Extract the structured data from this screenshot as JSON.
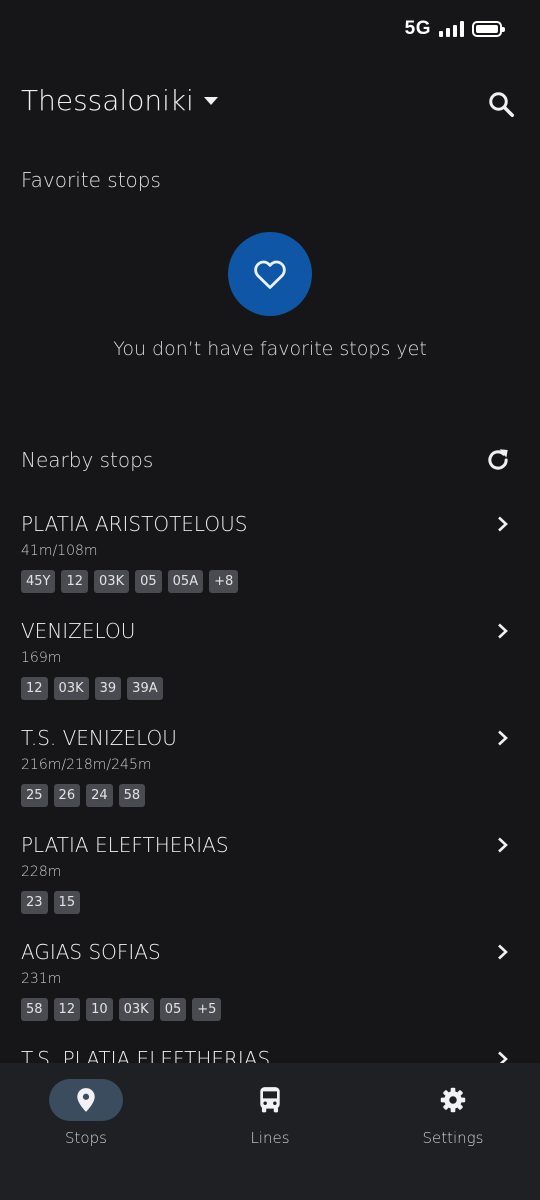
{
  "status_bar": {
    "network": "5G"
  },
  "header": {
    "city": "Thessaloniki"
  },
  "favorites": {
    "title": "Favorite stops",
    "empty_message": "You don’t have favorite stops yet"
  },
  "nearby": {
    "title": "Nearby stops",
    "stops": [
      {
        "name": "PLATIA ARISTOTELOUS",
        "distance": "41m/108m",
        "lines": [
          "45Y",
          "12",
          "03K",
          "05",
          "05A",
          "+8"
        ]
      },
      {
        "name": "VENIZELOU",
        "distance": "169m",
        "lines": [
          "12",
          "03K",
          "39",
          "39A"
        ]
      },
      {
        "name": "T.S. VENIZELOU",
        "distance": "216m/218m/245m",
        "lines": [
          "25",
          "26",
          "24",
          "58"
        ]
      },
      {
        "name": "PLATIA ELEFTHERIAS",
        "distance": "228m",
        "lines": [
          "23",
          "15"
        ]
      },
      {
        "name": "AGIAS SOFIAS",
        "distance": "231m",
        "lines": [
          "58",
          "12",
          "10",
          "03K",
          "05",
          "+5"
        ]
      },
      {
        "name": "T.S. PLATIA ELEFTHERIAS",
        "distance": "",
        "lines": []
      }
    ]
  },
  "nav": {
    "stops": "Stops",
    "lines": "Lines",
    "settings": "Settings"
  },
  "colors": {
    "background": "#161618",
    "accent": "#0f57a6",
    "chip": "#4a4b50",
    "nav_active": "#3a4c5e"
  }
}
